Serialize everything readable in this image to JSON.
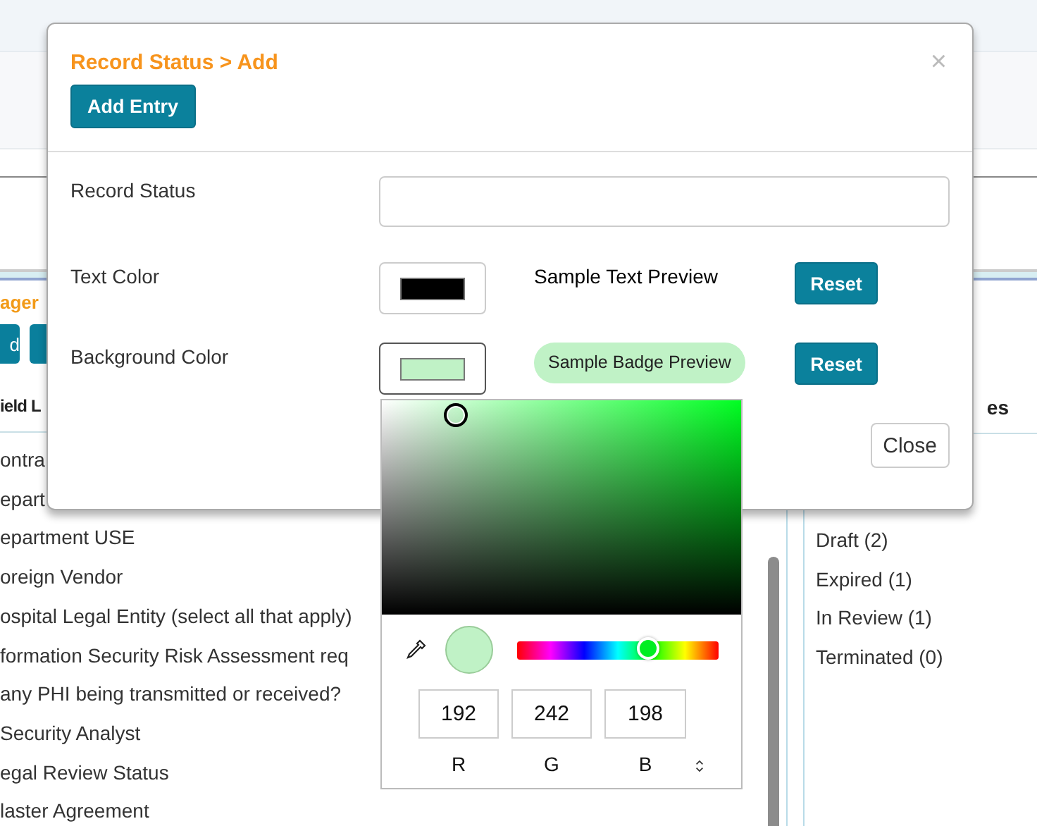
{
  "background_page": {
    "breadcrumb": "ager",
    "buttons": [
      "d"
    ],
    "field_list": {
      "header": "ield L",
      "items": [
        "ontra",
        "epart",
        "epartment USE",
        "oreign Vendor",
        "ospital Legal Entity (select all that apply)",
        "formation Security Risk Assessment req",
        "any PHI being transmitted or received?",
        "Security Analyst",
        "egal Review Status",
        "laster Agreement"
      ]
    },
    "status_list": {
      "header": "es",
      "items": [
        "Draft (2)",
        "Expired (1)",
        "In Review (1)",
        "Terminated (0)"
      ]
    }
  },
  "dialog": {
    "title": "Record Status > Add",
    "add_button": "Add Entry",
    "close_icon": "×",
    "fields": [
      {
        "kind": "text",
        "label": "Record Status"
      },
      {
        "kind": "color",
        "label": "Text Color",
        "color": "#000000",
        "preview": {
          "kind": "text",
          "text": "Sample Text Preview"
        },
        "reset": "Reset",
        "active": false
      },
      {
        "kind": "color",
        "label": "Background Color",
        "color": "#c0f2c6",
        "preview": {
          "kind": "badge",
          "text": "Sample Badge Preview"
        },
        "reset": "Reset",
        "active": true
      }
    ],
    "close_button": "Close"
  },
  "color_picker": {
    "color": "#c0f2c6",
    "hue": {
      "level": 0.65
    },
    "channels": [
      {
        "label": "R",
        "value": "192"
      },
      {
        "label": "G",
        "value": "242"
      },
      {
        "label": "B",
        "value": "198"
      }
    ]
  }
}
